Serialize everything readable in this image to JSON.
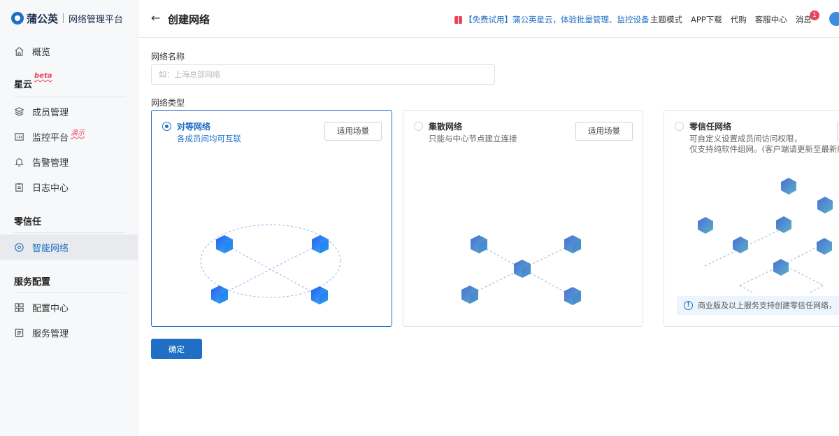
{
  "app": {
    "brand": "蒲公英",
    "subtitle": "网络管理平台"
  },
  "sidebar": {
    "overview": "概览",
    "sections": [
      {
        "title": "星云",
        "tag": "beta"
      },
      {
        "title": "零信任"
      },
      {
        "title": "服务配置"
      }
    ],
    "items": [
      {
        "label": "成员管理"
      },
      {
        "label": "监控平台",
        "tag": "演示"
      },
      {
        "label": "告警管理"
      },
      {
        "label": "日志中心"
      },
      {
        "label": "智能网络",
        "active": true
      },
      {
        "label": "配置中心"
      },
      {
        "label": "服务管理"
      }
    ]
  },
  "header": {
    "title": "创建网络",
    "promo": "【免费试用】蒲公英星云，体验批量管理、监控设备",
    "links": [
      "主题模式",
      "APP下载",
      "代购",
      "客服中心",
      "消息"
    ],
    "message_count": "1"
  },
  "form": {
    "name_label": "网络名称",
    "name_placeholder": "如：上海总部网络",
    "type_label": "网络类型",
    "cards": [
      {
        "title": "对等网络",
        "desc": [
          "各成员间均可互联"
        ],
        "button": "适用场景",
        "selected": true
      },
      {
        "title": "集散网络",
        "desc": [
          "只能与中心节点建立连接"
        ],
        "button": "适用场景",
        "selected": false
      },
      {
        "title": "零信任网络",
        "desc": [
          "可自定义设置成员间访问权限，",
          "仅支持纯软件组网。(客户端请更新至最新版"
        ],
        "notice": "商业版及以上服务支持创建零信任网络，",
        "selected": false
      }
    ],
    "confirm": "确定"
  },
  "colors": {
    "accent": "#1f6fc5",
    "badge": "#e8455c"
  }
}
